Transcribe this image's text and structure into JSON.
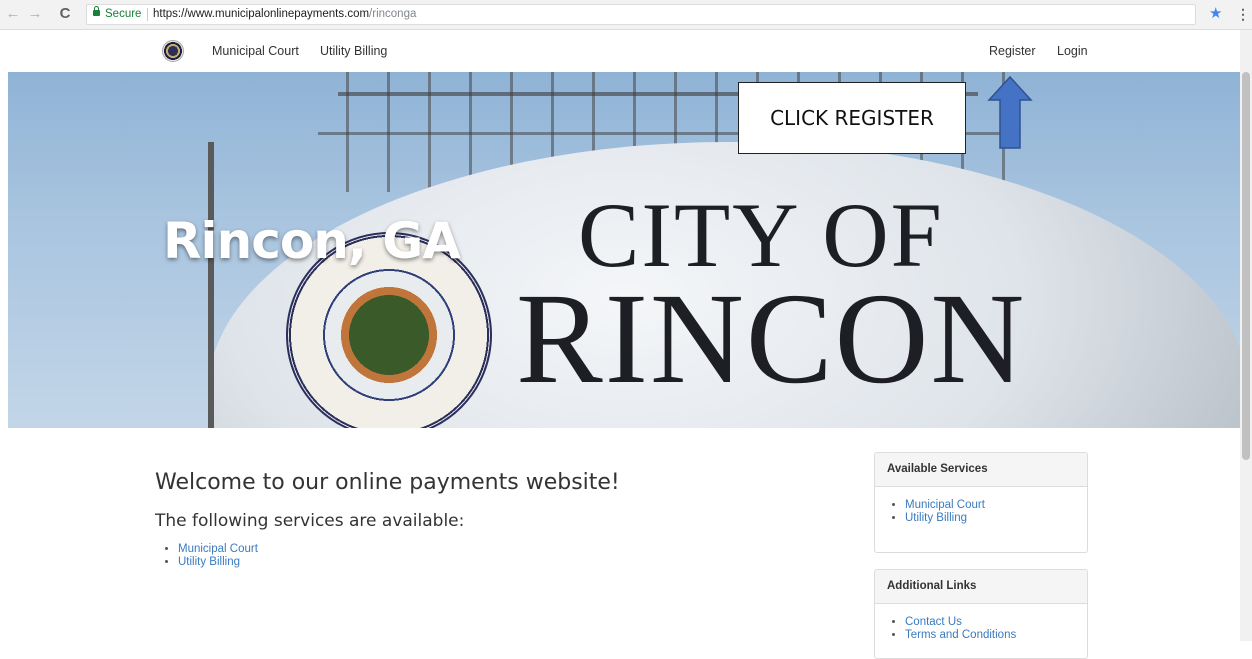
{
  "browser": {
    "secure_label": "Secure",
    "url_host": "https://www.municipalonlinepayments.com",
    "url_path": "/rinconga",
    "back_glyph": "←",
    "forward_glyph": "→",
    "reload_glyph": "C",
    "bookmark_glyph": "★",
    "menu_glyph": "⋮"
  },
  "navbar": {
    "links": [
      {
        "label": "Municipal Court"
      },
      {
        "label": "Utility Billing"
      }
    ],
    "register_label": "Register",
    "login_label": "Login"
  },
  "hero": {
    "title": "Rincon, GA",
    "tower_line1": "CITY OF",
    "tower_line2": "RINCON"
  },
  "annotation": {
    "text": "CLICK REGISTER",
    "arrow_color": "#4472c4"
  },
  "main": {
    "welcome": "Welcome to our online payments website!",
    "subheading": "The following services are available:",
    "services": [
      "Municipal Court",
      "Utility Billing"
    ]
  },
  "sidebar": {
    "available_services": {
      "title": "Available Services",
      "items": [
        "Municipal Court",
        "Utility Billing"
      ]
    },
    "additional_links": {
      "title": "Additional Links",
      "items": [
        "Contact Us",
        "Terms and Conditions"
      ]
    }
  },
  "colors": {
    "link": "#3a7bbf",
    "secure": "#188038",
    "bookmark": "#4285f4"
  }
}
